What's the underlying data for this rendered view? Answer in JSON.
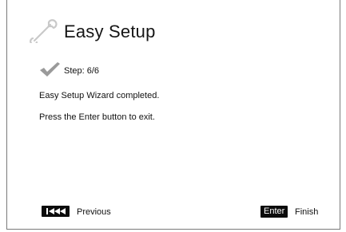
{
  "header": {
    "title": "Easy Setup",
    "icon": "wrench-icon"
  },
  "status": {
    "step_text": "Step: 6/6",
    "icon": "checkmark-icon"
  },
  "messages": [
    "Easy Setup Wizard completed.",
    "Press the Enter button to exit."
  ],
  "footer": {
    "previous_icon": "skip-back-icon",
    "previous_label": "Previous",
    "enter_key_label": "Enter",
    "finish_label": "Finish"
  },
  "colors": {
    "background": "#ffffff",
    "text": "#111111",
    "key_background": "#0c0c0c",
    "icon_gray": "#c9c9c9",
    "check_gray": "#9a9a9a"
  }
}
